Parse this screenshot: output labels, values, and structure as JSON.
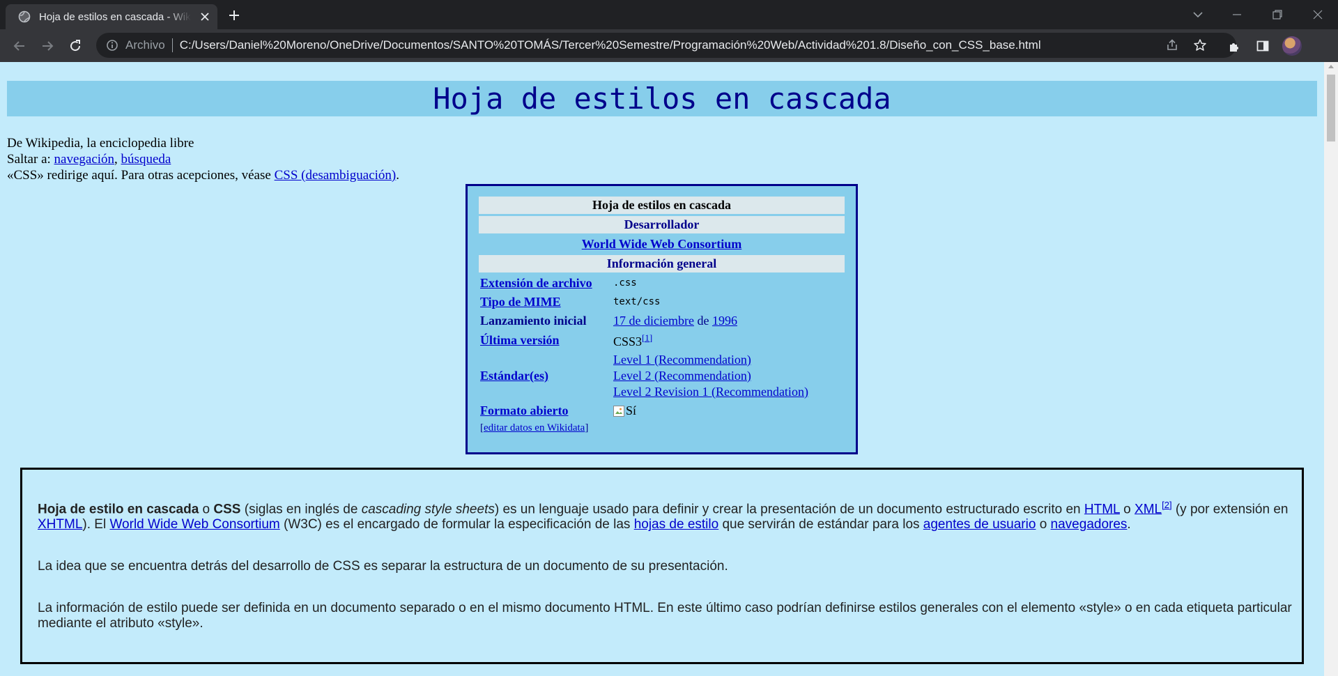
{
  "browser": {
    "tab_title": "Hoja de estilos en cascada - Wikipedia",
    "url_scheme": "Archivo",
    "url": "C:/Users/Daniel%20Moreno/OneDrive/Documentos/SANTO%20TOMÁS/Tercer%20Semestre/Programación%20Web/Actividad%201.8/Diseño_con_CSS_base.html",
    "icons": [
      "globe-icon",
      "close-icon",
      "plus-icon",
      "chevron-down-icon",
      "minimize-icon",
      "restore-icon",
      "window-close-icon",
      "back-icon",
      "forward-icon",
      "reload-icon",
      "info-icon",
      "share-icon",
      "star-icon",
      "extensions-icon",
      "side-panel-icon",
      "avatar"
    ]
  },
  "page": {
    "heading": "Hoja de estilos en cascada",
    "intro": {
      "line1": "De Wikipedia, la enciclopedia libre",
      "skip_prefix": "Saltar a: ",
      "skip_nav": "navegación",
      "skip_sep": ", ",
      "skip_search": "búsqueda",
      "redirect_prefix": "«CSS» redirige aquí. Para otras acepciones, véase ",
      "redirect_link": "CSS (desambiguación)",
      "redirect_suffix": "."
    },
    "infobox": {
      "title": "Hoja de estilos en cascada",
      "developer_header": "Desarrollador",
      "developer": "World Wide Web Consortium",
      "general_header": "Información general",
      "rows": {
        "extension_label": "Extensión de archivo",
        "extension_value": ".css",
        "mime_label": "Tipo de MIME",
        "mime_value": "text/css",
        "launch_label": "Lanzamiento inicial",
        "launch_date": "17 de diciembre",
        "launch_de": " de ",
        "launch_year": "1996",
        "version_label": "Última versión",
        "version_value": "CSS3",
        "version_ref": "[1]",
        "standards_label": "Estándar(es)",
        "standard1": "Level 1 (Recommendation)",
        "standard2": "Level 2 (Recommendation)",
        "standard3": "Level 2 Revision 1 (Recommendation)",
        "open_label": "Formato abierto",
        "open_value": "Sí"
      },
      "edit_open": "[",
      "edit_link": "editar datos en Wikidata",
      "edit_close": "]"
    },
    "article": {
      "p1": {
        "b1": "Hoja de estilo en cascada",
        "t1": " o ",
        "b2": "CSS",
        "t2": " (siglas en inglés de ",
        "i1": "cascading style sheets",
        "t3": ") es un lenguaje usado para definir y crear la presentación de un documento estructurado escrito en ",
        "l_html": "HTML",
        "t4": " o ",
        "l_xml": "XML",
        "ref2": "[2]",
        "t5": " (y por extensión en ",
        "l_xhtml": "XHTML",
        "t6": "). El ",
        "l_w3c": "World Wide Web Consortium",
        "t7": " (W3C) es el encargado de formular la especificación de las ",
        "l_hojas": "hojas de estilo",
        "t8": " que servirán de estándar para los ",
        "l_agentes": "agentes de usuario",
        "t9": " o ",
        "l_nav": "navegadores",
        "t10": "."
      },
      "p2": "La idea que se encuentra detrás del desarrollo de CSS es separar la estructura de un documento de su presentación.",
      "p3": "La información de estilo puede ser definida en un documento separado o en el mismo documento HTML. En este último caso podrían definirse estilos generales con el elemento «style» o en cada etiqueta particular mediante el atributo «style»."
    }
  },
  "colors": {
    "page_bg": "#c3ebfb",
    "header_bg": "#87ceeb",
    "header_text": "#00008b",
    "link": "#0000cc",
    "chrome_dark": "#202124",
    "chrome_mid": "#35363a"
  }
}
